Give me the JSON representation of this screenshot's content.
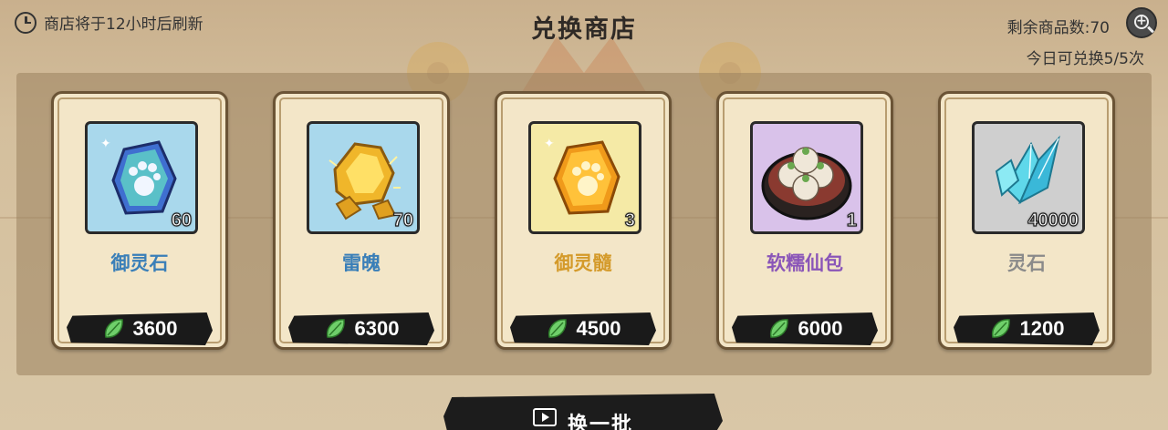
{
  "header": {
    "refresh_text": "商店将于12小时后刷新",
    "title": "兑换商店",
    "remaining_label": "剩余商品数:70",
    "daily_label": "今日可兑换5/5次"
  },
  "items": [
    {
      "name": "御灵石",
      "quantity": "60",
      "price": "3600",
      "name_color": "#3a7fb8",
      "bg_color": "#a9d8ec",
      "icon": "blue-paw-gem-icon"
    },
    {
      "name": "雷魄",
      "quantity": "70",
      "price": "6300",
      "name_color": "#3a7fb8",
      "bg_color": "#a9d8ec",
      "icon": "gold-thunder-ore-icon"
    },
    {
      "name": "御灵髓",
      "quantity": "3",
      "price": "4500",
      "name_color": "#d49a2a",
      "bg_color": "#f5eaa6",
      "icon": "gold-paw-gem-icon"
    },
    {
      "name": "软糯仙包",
      "quantity": "1",
      "price": "6000",
      "name_color": "#8a55b8",
      "bg_color": "#d9c2ea",
      "icon": "steamed-buns-icon"
    },
    {
      "name": "灵石",
      "quantity": "40000",
      "price": "1200",
      "name_color": "#8a8a8a",
      "bg_color": "#cfcfcf",
      "icon": "cyan-crystal-icon"
    }
  ],
  "refresh_button": {
    "label": "换一批"
  },
  "currency_icon": "green-leaf-currency-icon"
}
